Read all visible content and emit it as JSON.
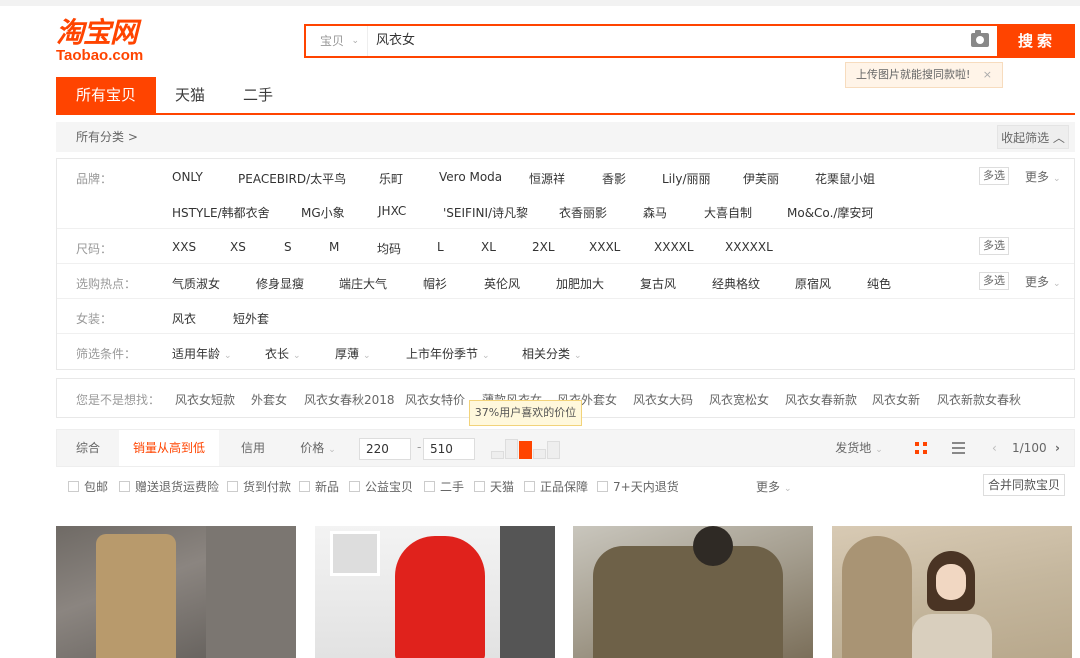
{
  "logo": {
    "cn": "淘宝网",
    "en": "Taobao.com"
  },
  "search": {
    "category": "宝贝",
    "query": "风衣女",
    "button": "搜索",
    "upload_tip": "上传图片就能搜同款啦!",
    "close": "×"
  },
  "tabs": [
    "所有宝贝",
    "天猫",
    "二手"
  ],
  "catbar": {
    "all": "所有分类 >",
    "fold": "收起筛选 ︿"
  },
  "filters": {
    "brand_label": "品牌：",
    "brands_row1": [
      "ONLY",
      "PEACEBIRD/太平鸟",
      "乐町",
      "Vero Moda",
      "恒源祥",
      "香影",
      "Lily/丽丽",
      "伊芙丽",
      "花栗鼠小姐"
    ],
    "brands_row2": [
      "HSTYLE/韩都衣舍",
      "MG小象",
      "JHXC",
      "'SEIFINI/诗凡黎",
      "衣香丽影",
      "森马",
      "大喜自制",
      "Mo&Co./摩安珂"
    ],
    "size_label": "尺码：",
    "sizes": [
      "XXS",
      "XS",
      "S",
      "M",
      "均码",
      "L",
      "XL",
      "2XL",
      "XXXL",
      "XXXXL",
      "XXXXXL"
    ],
    "hot_label": "选购热点：",
    "hot": [
      "气质淑女",
      "修身显瘦",
      "端庄大气",
      "帽衫",
      "英伦风",
      "加肥加大",
      "复古风",
      "经典格纹",
      "原宿风",
      "纯色"
    ],
    "women_label": "女装：",
    "women": [
      "风衣",
      "短外套"
    ],
    "cond_label": "筛选条件：",
    "conds": [
      "适用年龄",
      "衣长",
      "厚薄",
      "上市年份季节",
      "相关分类"
    ],
    "multi": "多选",
    "more": "更多"
  },
  "suggest": {
    "label": "您是不是想找：",
    "items": [
      "风衣女短款",
      "外套女",
      "风衣女春秋2018",
      "风衣女特价",
      "薄款风衣女",
      "风衣外套女",
      "风衣女大码",
      "风衣宽松女",
      "风衣女春新款",
      "风衣女新",
      "风衣新款女春秋"
    ]
  },
  "sort": {
    "items": [
      "综合",
      "销量从高到低",
      "信用",
      "价格"
    ],
    "price_min": "220",
    "price_max": "510",
    "dash": "-",
    "price_tip": "37%用户喜欢的价位",
    "ship": "发货地",
    "page": "1/100"
  },
  "options": [
    "包邮",
    "赠送退货运费险",
    "货到付款",
    "新品",
    "公益宝贝",
    "二手",
    "天猫",
    "正品保障",
    "7+天内退货"
  ],
  "options_more": "更多",
  "merge": "合并同款宝贝",
  "colors": {
    "accent": "#ff4400"
  }
}
